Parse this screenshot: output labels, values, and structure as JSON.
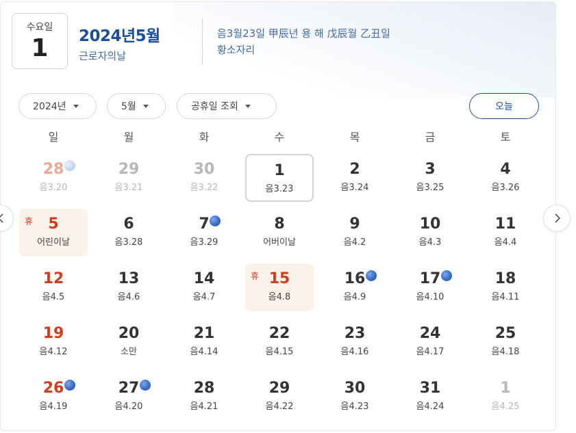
{
  "header": {
    "dow": "수요일",
    "day": "1",
    "year_month": "2024년5월",
    "holiday": "근로자의날",
    "lunar_line1": "음3월23일 甲辰년 용 해 戊辰월 乙丑일",
    "lunar_line2": "황소자리"
  },
  "controls": {
    "year": "2024년",
    "month": "5월",
    "holiday_lookup": "공휴일 조회",
    "today": "오늘"
  },
  "weekdays": [
    "일",
    "월",
    "화",
    "수",
    "목",
    "금",
    "토"
  ],
  "weeks": [
    [
      {
        "n": "28",
        "s": "음3.20",
        "other": true,
        "dot": "light"
      },
      {
        "n": "29",
        "s": "음3.21",
        "other": true
      },
      {
        "n": "30",
        "s": "음3.22",
        "other": true
      },
      {
        "n": "1",
        "s": "음3.23",
        "today": true
      },
      {
        "n": "2",
        "s": "음3.24"
      },
      {
        "n": "3",
        "s": "음3.25"
      },
      {
        "n": "4",
        "s": "음3.26"
      }
    ],
    [
      {
        "n": "5",
        "s": "어린이날",
        "holiday": true,
        "hyu": "휴"
      },
      {
        "n": "6",
        "s": "음3.28"
      },
      {
        "n": "7",
        "s": "음3.29",
        "dot": "dark"
      },
      {
        "n": "8",
        "s": "어버이날"
      },
      {
        "n": "9",
        "s": "음4.2"
      },
      {
        "n": "10",
        "s": "음4.3"
      },
      {
        "n": "11",
        "s": "음4.4"
      }
    ],
    [
      {
        "n": "12",
        "s": "음4.5"
      },
      {
        "n": "13",
        "s": "음4.6"
      },
      {
        "n": "14",
        "s": "음4.7"
      },
      {
        "n": "15",
        "s": "음4.8",
        "holiday": true,
        "hyu": "휴",
        "red": true
      },
      {
        "n": "16",
        "s": "음4.9",
        "dot": "dark"
      },
      {
        "n": "17",
        "s": "음4.10",
        "dot": "dark"
      },
      {
        "n": "18",
        "s": "음4.11"
      }
    ],
    [
      {
        "n": "19",
        "s": "음4.12"
      },
      {
        "n": "20",
        "s": "소만"
      },
      {
        "n": "21",
        "s": "음4.14"
      },
      {
        "n": "22",
        "s": "음4.15"
      },
      {
        "n": "23",
        "s": "음4.16"
      },
      {
        "n": "24",
        "s": "음4.17"
      },
      {
        "n": "25",
        "s": "음4.18"
      }
    ],
    [
      {
        "n": "26",
        "s": "음4.19",
        "dot": "dark"
      },
      {
        "n": "27",
        "s": "음4.20",
        "dot": "dark"
      },
      {
        "n": "28",
        "s": "음4.21"
      },
      {
        "n": "29",
        "s": "음4.22"
      },
      {
        "n": "30",
        "s": "음4.23"
      },
      {
        "n": "31",
        "s": "음4.24"
      },
      {
        "n": "1",
        "s": "음4.25",
        "other": true
      }
    ]
  ],
  "icons": {
    "prev": "chevron-left-icon",
    "next": "chevron-right-icon",
    "caret": "caret-down-icon"
  }
}
